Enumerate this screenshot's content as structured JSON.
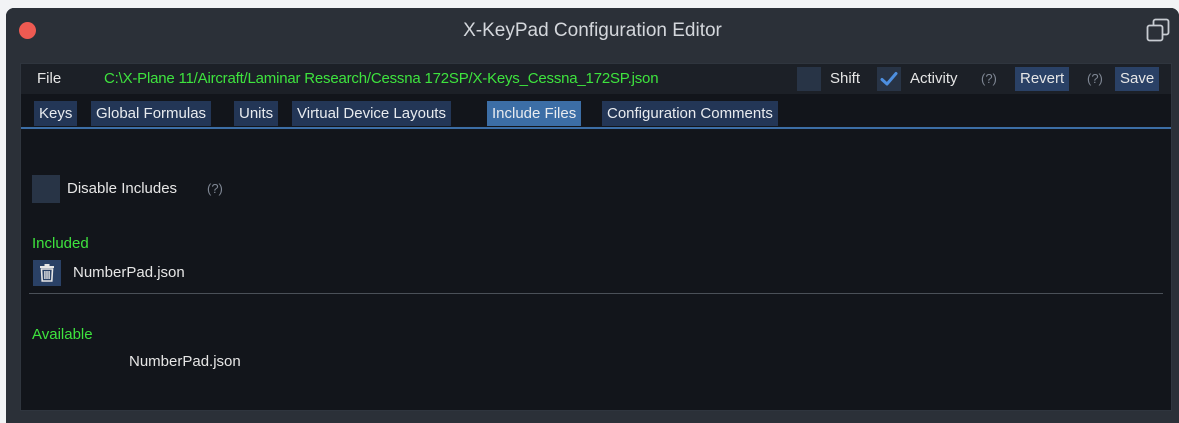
{
  "window": {
    "title": "X-KeyPad Configuration Editor",
    "close_icon": "close-dot-icon",
    "popout_icon": "popout-window-icon"
  },
  "menubar": {
    "file_label": "File",
    "file_path": "C:\\X-Plane 11/Aircraft/Laminar Research/Cessna 172SP/X-Keys_Cessna_172SP.json",
    "shift_label": "Shift",
    "shift_checked": false,
    "activity_label": "Activity",
    "activity_checked": true,
    "activity_help": "(?)",
    "revert_label": "Revert",
    "save_help": "(?)",
    "save_label": "Save"
  },
  "tabs": [
    {
      "label": "Keys",
      "active": false
    },
    {
      "label": "Global Formulas",
      "active": false
    },
    {
      "label": "Units",
      "active": false
    },
    {
      "label": "Virtual Device Layouts",
      "active": false
    },
    {
      "label": "Include Files",
      "active": true
    },
    {
      "label": "Configuration Comments",
      "active": false
    }
  ],
  "include_files": {
    "disable_includes_label": "Disable Includes",
    "disable_includes_checked": false,
    "disable_includes_help": "(?)",
    "included_header": "Included",
    "included": [
      {
        "name": "NumberPad.json",
        "action_icon": "trash-icon"
      }
    ],
    "available_header": "Available",
    "available": [
      {
        "name": "NumberPad.json"
      }
    ]
  },
  "colors": {
    "accent": "#3c6ea6",
    "path_green": "#3ee33e",
    "close_red": "#ee5a52",
    "tab_bg": "#233656"
  }
}
